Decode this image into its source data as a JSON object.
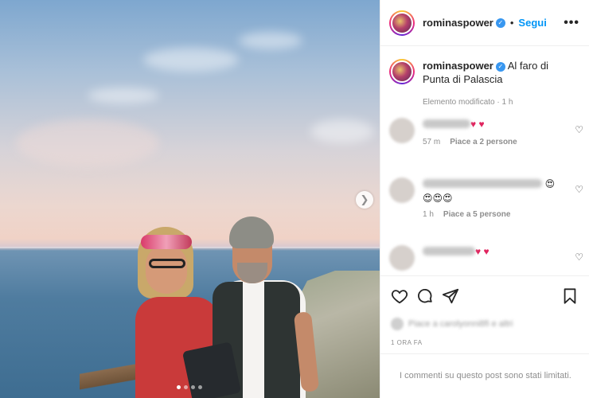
{
  "post": {
    "username": "rominaspower",
    "follow_label": "Segui",
    "separator": "•",
    "more_label": "•••",
    "verified_mark": "✓",
    "caption_text": "Al faro di Punta di Palascia",
    "caption_meta": "Elemento modificato · 1 h",
    "carousel": {
      "dots": 4,
      "active_dot": 1
    }
  },
  "comments": [
    {
      "name": "lucia8812",
      "text": "♥ ♥",
      "time": "57 m",
      "likes": "Piace a 2 persone"
    },
    {
      "name": "carolasantosblansangue",
      "text": "😍",
      "text2": "😍😍😍",
      "time": "1 h",
      "likes": "Piace a 5 persone"
    },
    {
      "name": "valeria6833",
      "text": "♥ ♥",
      "time": "",
      "likes": ""
    }
  ],
  "footer": {
    "likes_prefix": "Piace a",
    "likes_blurred": "carolyonni8fi e altri",
    "timestamp": "1 ORA FA",
    "limited_notice": "I commenti su questo post sono stati limitati."
  },
  "icons": {
    "heart": "heart-icon",
    "comment": "comment-icon",
    "share": "share-icon",
    "save": "bookmark-icon",
    "next": "chevron-right-icon"
  },
  "colors": {
    "accent": "#0095f6",
    "verified": "#3897f0",
    "heart_red": "#e0245e",
    "muted": "#8e8e8e"
  }
}
